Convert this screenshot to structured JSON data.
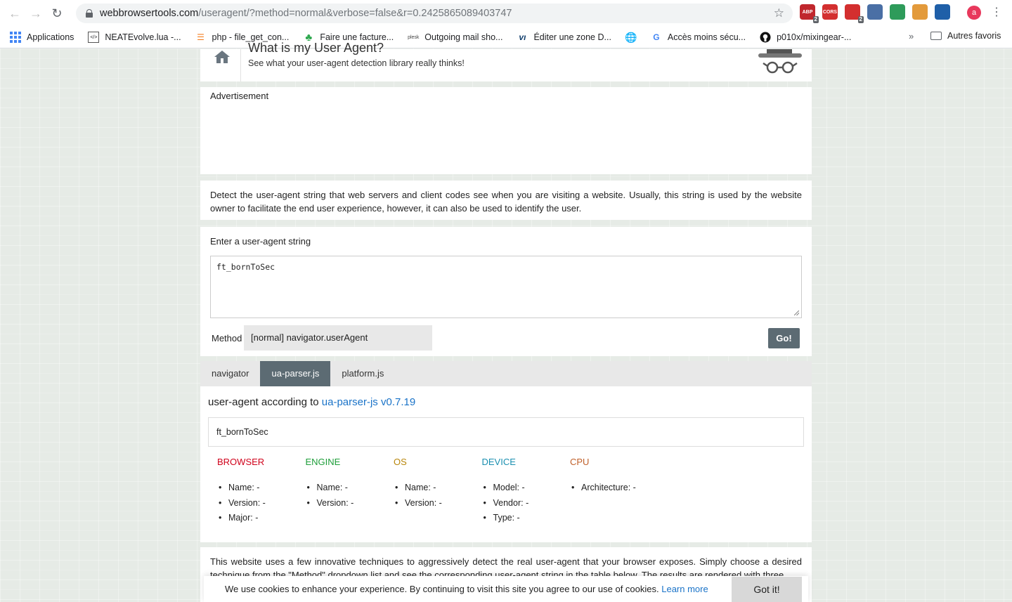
{
  "browser": {
    "url_host": "webbrowsertools.com",
    "url_path": "/useragent/?method=normal&verbose=false&r=0.2425865089403747",
    "extensions": [
      {
        "name": "abp-icon",
        "label": "ABP",
        "badge": "2",
        "color": "#c0272d"
      },
      {
        "name": "cors-icon",
        "label": "CORS",
        "badge": "",
        "color": "#d32f2f"
      },
      {
        "name": "ublock-icon",
        "label": "",
        "badge": "2",
        "color": "#d32f2f"
      },
      {
        "name": "eyedropper-icon",
        "label": "",
        "badge": "",
        "color": "#4a6fa5"
      },
      {
        "name": "recycle-icon",
        "label": "",
        "badge": "",
        "color": "#2e9b5a"
      },
      {
        "name": "puzzle-icon",
        "label": "",
        "badge": "",
        "color": "#e39a3b"
      },
      {
        "name": "globe-icon",
        "label": "",
        "badge": "",
        "color": "#1f5fa8"
      }
    ],
    "profile_initial": "a"
  },
  "bookmarks": {
    "items": [
      "Applications",
      "NEATEvolve.lua -...",
      "php - file_get_con...",
      "Faire une facture...",
      "Outgoing mail sho...",
      "Éditer une zone D...",
      "",
      "Accès moins sécu...",
      "p010x/mixingear-..."
    ],
    "more": "»",
    "other": "Autres favoris"
  },
  "header": {
    "title": "What is my User Agent?",
    "subtitle": "See what your user-agent detection library really thinks!"
  },
  "ad": {
    "label": "Advertisement"
  },
  "intro": {
    "text": "Detect the user-agent string that web servers and client codes see when you are visiting a website. Usually, this string is used by the website owner to facilitate the end user experience, however, it can also be used to identify the user."
  },
  "form": {
    "label": "Enter a user-agent string",
    "ua_value": "ft_bornToSec",
    "method_label": "Method",
    "method_value": "[normal] navigator.userAgent",
    "go_label": "Go!"
  },
  "tabs": [
    "navigator",
    "ua-parser.js",
    "platform.js"
  ],
  "result": {
    "heading_prefix": "user-agent according to",
    "heading_link": "ua-parser-js v0.7.19",
    "ua": "ft_bornToSec",
    "columns": [
      {
        "title": "BROWSER",
        "color": "#d0021b",
        "items": [
          "Name: -",
          "Version: -",
          "Major: -"
        ]
      },
      {
        "title": "ENGINE",
        "color": "#1e9e3a",
        "items": [
          "Name: -",
          "Version: -"
        ]
      },
      {
        "title": "OS",
        "color": "#b8860b",
        "items": [
          "Name: -",
          "Version: -"
        ]
      },
      {
        "title": "DEVICE",
        "color": "#1a8fb0",
        "items": [
          "Model: -",
          "Vendor: -",
          "Type: -"
        ]
      },
      {
        "title": "CPU",
        "color": "#c0602a",
        "items": [
          "Architecture: -"
        ]
      }
    ]
  },
  "bottom": {
    "text": "This website uses a few innovative techniques to aggressively detect the real user-agent that your browser exposes. Simply choose a desired technique from the \"Method\" dropdown list and see the corresponding user-agent string in the table below. The results are rendered with three"
  },
  "cookie": {
    "text": "We use cookies to enhance your experience. By continuing to visit this site you agree to our use of cookies.",
    "link": "Learn more",
    "button": "Got it!"
  }
}
